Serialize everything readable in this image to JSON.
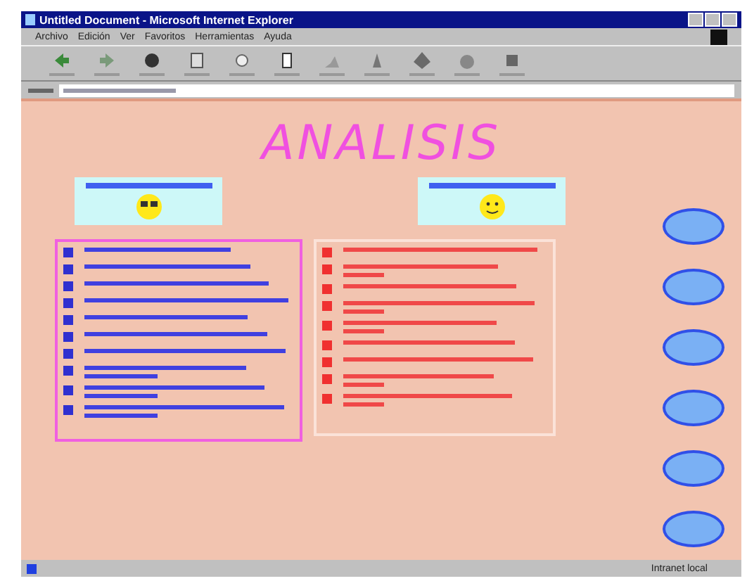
{
  "window": {
    "title": "Untitled Document - Microsoft Internet Explorer"
  },
  "menu": [
    "Archivo",
    "Edición",
    "Ver",
    "Favoritos",
    "Herramientas",
    "Ayuda"
  ],
  "toolbar": [
    {
      "kind": "back"
    },
    {
      "kind": "forward"
    },
    {
      "kind": "stop"
    },
    {
      "kind": "refresh"
    },
    {
      "kind": "home"
    },
    {
      "kind": "search"
    },
    {
      "kind": "favorites"
    },
    {
      "kind": "history"
    },
    {
      "kind": "mail"
    },
    {
      "kind": "print"
    },
    {
      "kind": "edit"
    }
  ],
  "heading": "ANALISIS",
  "cards": [
    {
      "kind": "glasses"
    },
    {
      "kind": "smile"
    }
  ],
  "left_list": [
    {
      "kind": "one"
    },
    {
      "kind": "one"
    },
    {
      "kind": "one"
    },
    {
      "kind": "one"
    },
    {
      "kind": "one"
    },
    {
      "kind": "one"
    },
    {
      "kind": "one"
    },
    {
      "kind": "two"
    },
    {
      "kind": "two"
    },
    {
      "kind": "two"
    }
  ],
  "right_list": [
    {
      "kind": "one"
    },
    {
      "kind": "two"
    },
    {
      "kind": "one"
    },
    {
      "kind": "two"
    },
    {
      "kind": "two"
    },
    {
      "kind": "one"
    },
    {
      "kind": "one"
    },
    {
      "kind": "two"
    },
    {
      "kind": "two"
    }
  ],
  "nav_buttons": [
    {
      "kind": "oval"
    },
    {
      "kind": "oval"
    },
    {
      "kind": "oval"
    },
    {
      "kind": "oval"
    },
    {
      "kind": "oval"
    },
    {
      "kind": "oval"
    }
  ],
  "status_bar": {
    "zone": "Intranet local"
  }
}
